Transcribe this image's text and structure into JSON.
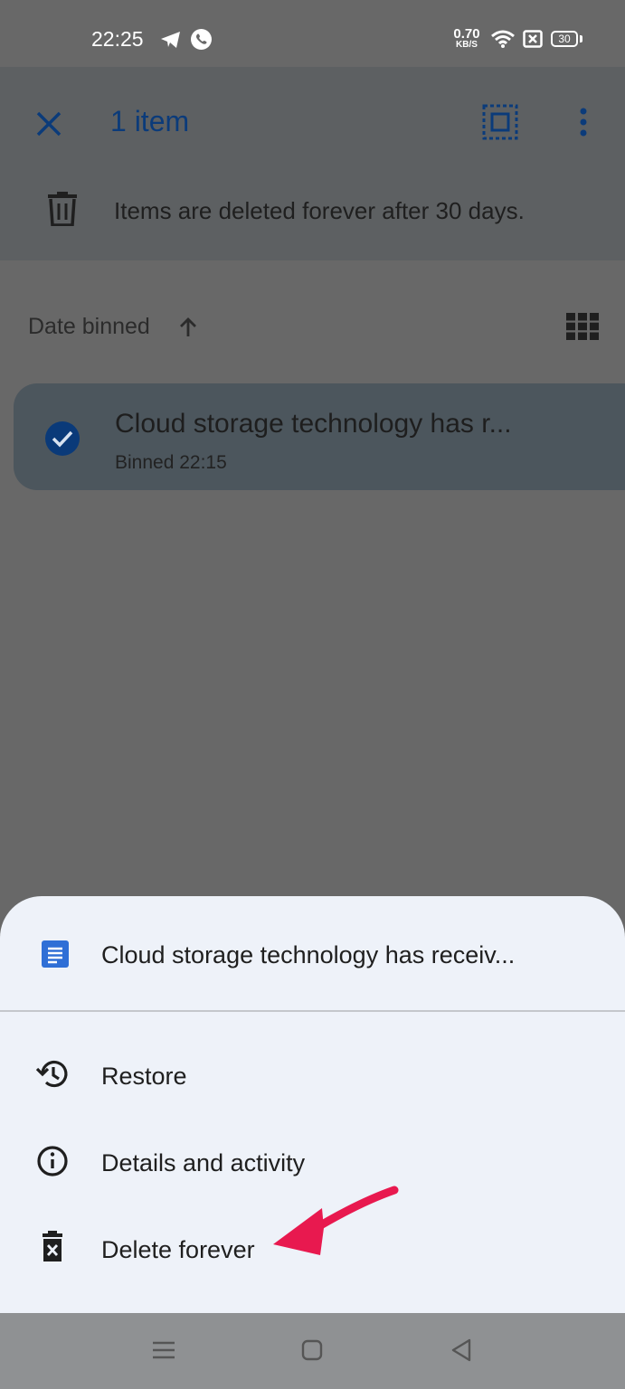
{
  "status_bar": {
    "time": "22:25",
    "net_speed_value": "0.70",
    "net_speed_unit": "KB/S",
    "battery": "30"
  },
  "header": {
    "selection_count": "1 item",
    "notice": "Items are deleted forever after 30 days."
  },
  "sort": {
    "label": "Date binned"
  },
  "item": {
    "title": "Cloud storage technology has r...",
    "binned": "Binned 22:15"
  },
  "sheet": {
    "doc_title": "Cloud storage technology has receiv...",
    "actions": [
      {
        "label": "Restore",
        "icon": "restore-history-icon"
      },
      {
        "label": "Details and activity",
        "icon": "info-icon"
      },
      {
        "label": "Delete forever",
        "icon": "delete-forever-icon"
      }
    ]
  },
  "colors": {
    "accent_blue": "#0b57d0",
    "annotation_arrow": "#e8194f",
    "sheet_bg": "#eef2f9"
  }
}
